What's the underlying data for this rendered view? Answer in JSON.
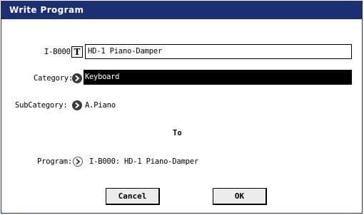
{
  "dialog": {
    "title": "Write Program",
    "name_row": {
      "label": "I-B000:",
      "text_button": "T",
      "value": "HD-1 Piano-Damper"
    },
    "category": {
      "label": "Category:",
      "value": "Keyboard"
    },
    "subcategory": {
      "label": "SubCategory:",
      "value": "A.Piano"
    },
    "to_label": "To",
    "program": {
      "label": "Program:",
      "value": "I-B000: HD-1 Piano-Damper"
    },
    "buttons": {
      "cancel": "Cancel",
      "ok": "OK"
    }
  },
  "colors": {
    "title_bar": "#1c2f73",
    "field_bg_selected": "#000000"
  },
  "icons": {
    "popup": "chevron-right-circle-icon",
    "text_edit": "T-button"
  }
}
